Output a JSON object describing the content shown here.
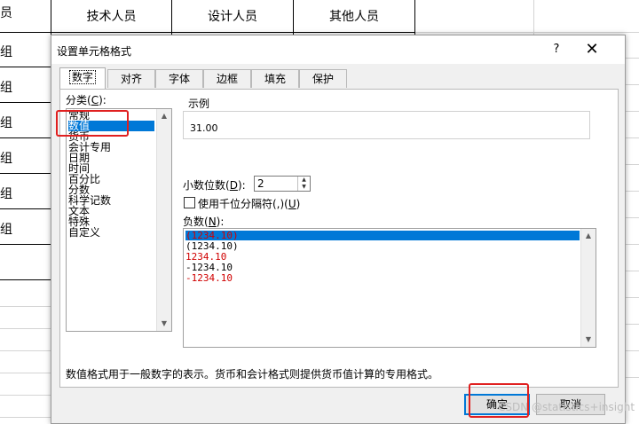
{
  "sheet": {
    "headers": [
      "技术人员",
      "设计人员",
      "其他人员"
    ],
    "header_partial": "员",
    "row_labels": [
      "组",
      "组",
      "组",
      "组",
      "组",
      "组"
    ]
  },
  "dialog": {
    "title": "设置单元格格式",
    "help": "?",
    "close": "✕",
    "tabs": [
      "数字",
      "对齐",
      "字体",
      "边框",
      "填充",
      "保护"
    ],
    "category_label": "分类(",
    "category_key": "C",
    "category_label_end": "):",
    "categories": [
      "常规",
      "数值",
      "货币",
      "会计专用",
      "日期",
      "时间",
      "百分比",
      "分数",
      "科学记数",
      "文本",
      "特殊",
      "自定义"
    ],
    "selected_category": "数值",
    "sample_label": "示例",
    "sample_value": "31.00",
    "decimal_label": "小数位数(",
    "decimal_key": "D",
    "decimal_label_end": "):",
    "decimal_value": "2",
    "thousands_label": "使用千位分隔符(,)(",
    "thousands_key": "U",
    "thousands_label_end": ")",
    "thousands_checked": false,
    "negative_label": "负数(",
    "negative_key": "N",
    "negative_label_end": "):",
    "negative_options": [
      "(1234.10)",
      "(1234.10)",
      "1234.10",
      "-1234.10",
      "-1234.10"
    ],
    "description": "数值格式用于一般数字的表示。货币和会计格式则提供货币值计算的专用格式。",
    "ok_label": "确定",
    "cancel_label": "取消"
  },
  "watermark": "CSDN @statistics+insight",
  "colors": {
    "selection": "#0078d7",
    "highlight_box": "#e02020",
    "negative_red": "#d00000"
  }
}
